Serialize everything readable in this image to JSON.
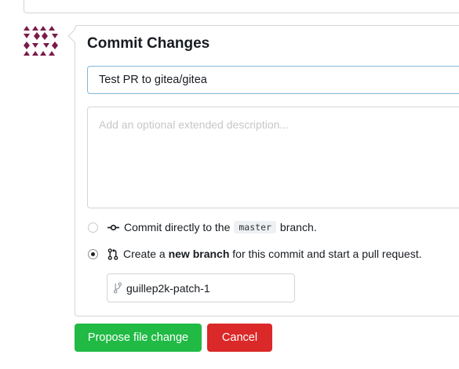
{
  "commit": {
    "title": "Commit Changes",
    "summary_value": "Test PR to gitea/gitea",
    "description_placeholder": "Add an optional extended description...",
    "options": {
      "direct": {
        "prefix": "Commit directly to the",
        "branch": "master",
        "suffix": "branch.",
        "selected": false
      },
      "new_branch": {
        "prefix": "Create a",
        "bold": "new branch",
        "suffix": "for this commit and start a pull request.",
        "selected": true
      }
    },
    "new_branch_name": "guillep2k-patch-1"
  },
  "buttons": {
    "propose": "Propose file change",
    "cancel": "Cancel"
  },
  "colors": {
    "avatar": "#7a1b4b",
    "propose_bg": "#21ba45",
    "cancel_bg": "#db2828",
    "focus_border": "#85b7d9"
  },
  "icons": {
    "avatar": "identicon-avatar",
    "commit": "git-commit-icon",
    "pull_request": "git-pull-request-icon",
    "branch": "git-branch-icon"
  }
}
